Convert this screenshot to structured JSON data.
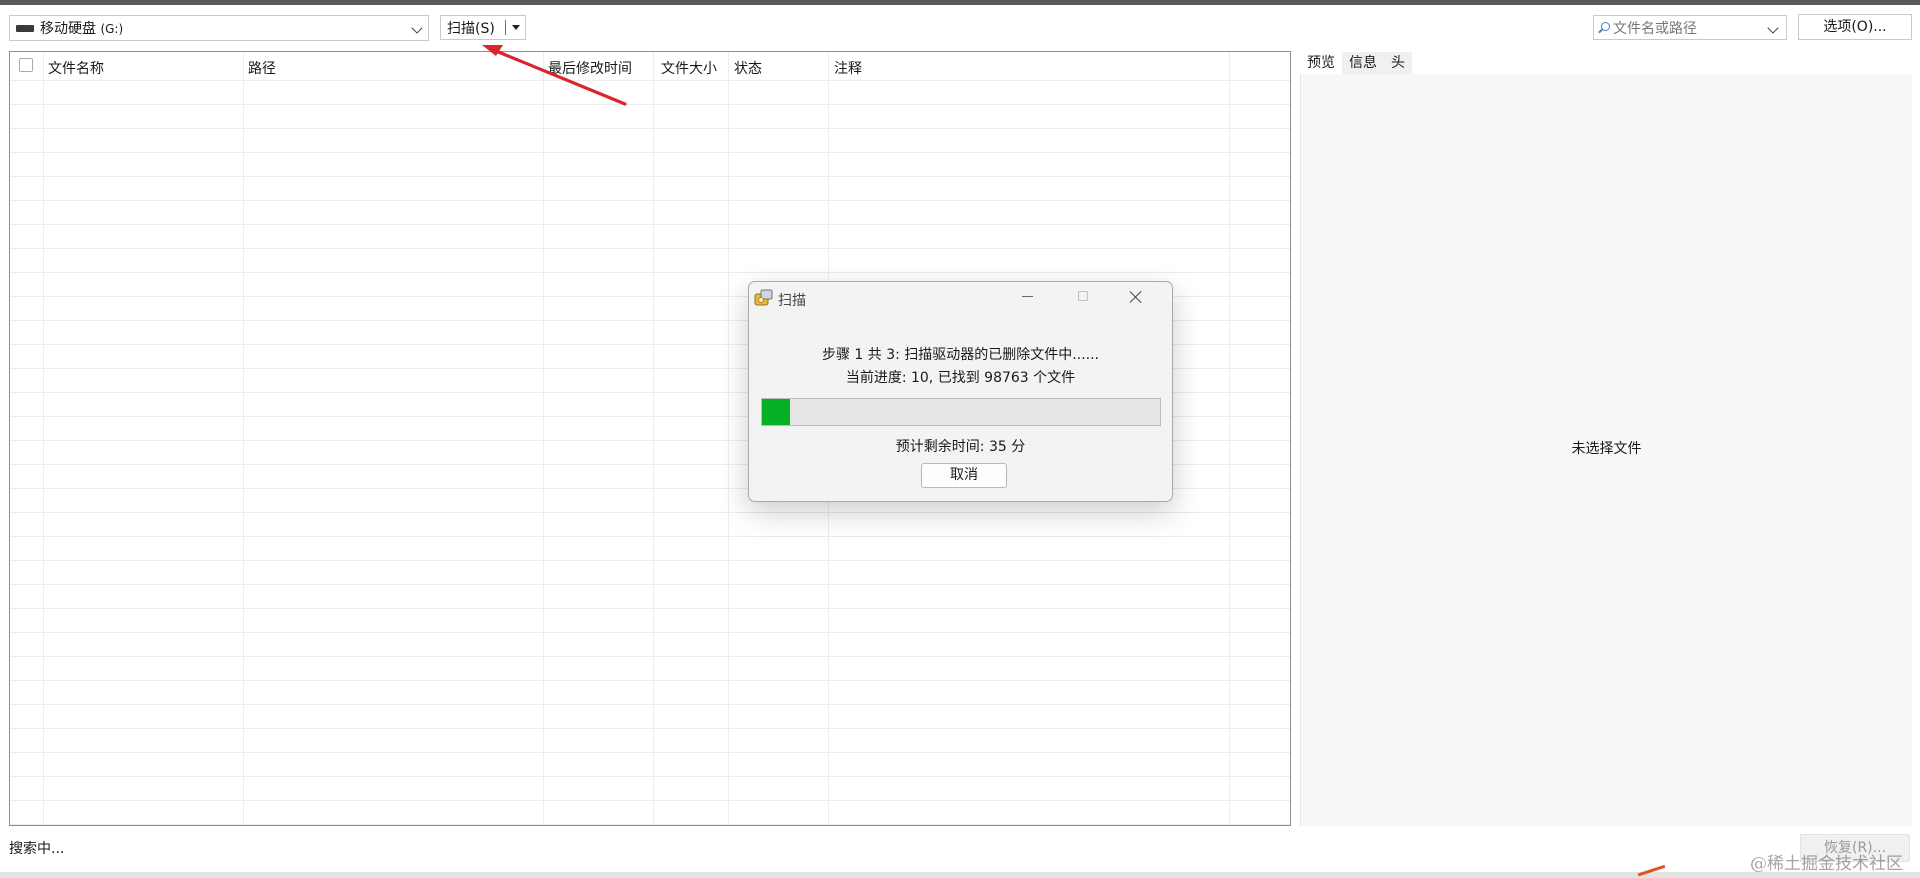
{
  "toolbar": {
    "drive_label": "移动硬盘",
    "drive_letter": "(G:)",
    "scan_label": "扫描(S)",
    "search_placeholder": "文件名或路径",
    "options_label": "选项(O)..."
  },
  "table": {
    "columns": [
      "文件名称",
      "路径",
      "最后修改时间",
      "文件大小",
      "状态",
      "注释"
    ],
    "rows": []
  },
  "preview": {
    "tabs": [
      "预览",
      "信息",
      "头"
    ],
    "active_tab": "预览",
    "empty_text": "未选择文件"
  },
  "status": {
    "text": "搜索中...",
    "recover_label": "恢复(R)..."
  },
  "watermark": "@稀土掘金技术社区",
  "dialog": {
    "title": "扫描",
    "step_text": "步骤 1 共 3: 扫描驱动器的已删除文件中......",
    "progress_text": "当前进度: 10, 已找到 98763 个文件",
    "progress_percent": 7,
    "eta_text": "预计剩余时间: 35 分",
    "cancel_label": "取消"
  },
  "colors": {
    "progress_fill": "#06b025",
    "annotation_arrow": "#d9252b"
  }
}
